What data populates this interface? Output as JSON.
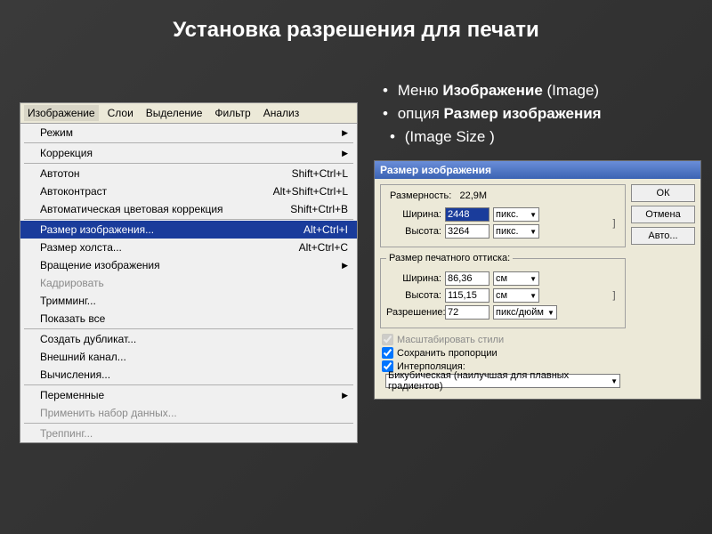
{
  "title": "Установка разрешения для печати",
  "bullet1_a": "Меню ",
  "bullet1_b": "Изображение",
  "bullet1_c": " (Image)",
  "bullet2_a": "опция ",
  "bullet2_b": "Размер изображения",
  "bullet2_c": "(Image Size )",
  "menubar": {
    "tabs": [
      "Изображение",
      "Слои",
      "Выделение",
      "Фильтр",
      "Анализ"
    ]
  },
  "menu": {
    "mode": "Режим",
    "corrections": "Коррекция",
    "autotone": "Автотон",
    "autotone_sc": "Shift+Ctrl+L",
    "autocontrast": "Автоконтраст",
    "autocontrast_sc": "Alt+Shift+Ctrl+L",
    "autocolor": "Автоматическая цветовая коррекция",
    "autocolor_sc": "Shift+Ctrl+B",
    "imagesize": "Размер изображения...",
    "imagesize_sc": "Alt+Ctrl+I",
    "canvassize": "Размер холста...",
    "canvassize_sc": "Alt+Ctrl+C",
    "rotation": "Вращение изображения",
    "crop": "Кадрировать",
    "trim": "Тримминг...",
    "revealall": "Показать все",
    "duplicate": "Создать дубликат...",
    "apply": "Внешний канал...",
    "calc": "Вычисления...",
    "vars": "Переменные",
    "applyds": "Применить набор данных...",
    "trap": "Треппинг..."
  },
  "dlg": {
    "title": "Размер изображения",
    "dim_label": "Размерность:",
    "dim_value": "22,9M",
    "width_l": "Ширина:",
    "height_l": "Высота:",
    "px_w": "2448",
    "px_h": "3264",
    "px_unit": "пикс.",
    "grp_print": "Размер печатного оттиска:",
    "pr_w": "86,36",
    "pr_h": "115,15",
    "pr_unit": "см",
    "res_l": "Разрешение:",
    "res_v": "72",
    "res_unit": "пикс/дюйм",
    "chk_scale": "Масштабировать стили",
    "chk_constrain": "Сохранить пропорции",
    "chk_resample": "Интерполяция:",
    "interp": "Бикубическая (наилучшая для плавных градиентов)",
    "ok": "ОК",
    "cancel": "Отмена",
    "auto": "Авто..."
  }
}
